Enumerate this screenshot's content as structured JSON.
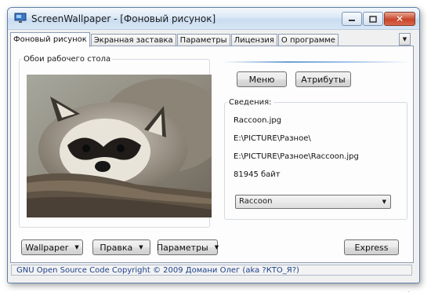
{
  "window": {
    "title": "ScreenWallpaper - [Фоновый рисунок]",
    "icon": "monitor-icon",
    "controls": {
      "minimize": "minimize-icon",
      "maximize": "maximize-icon",
      "close_label": "✕"
    }
  },
  "tabs": [
    {
      "label": "Фоновый рисунок",
      "active": true
    },
    {
      "label": "Экранная заставка"
    },
    {
      "label": "Параметры"
    },
    {
      "label": "Лицензия"
    },
    {
      "label": "О программе"
    }
  ],
  "tab_scroll_icon": "▼",
  "wallpaper_panel": {
    "legend": "Обои рабочего стола",
    "image": "raccoon-photo"
  },
  "top_buttons": {
    "menu": "Меню",
    "attributes": "Атрибуты"
  },
  "info": {
    "legend": "Сведения:",
    "file_name": "Raccoon.jpg",
    "folder": "E:\\PICTURE\\Разное\\",
    "full_path": "E:\\PICTURE\\Разное\\Raccoon.jpg",
    "size": "81945 байт",
    "selected_item": "Raccoon"
  },
  "bottom_buttons": {
    "wallpaper": "Wallpaper",
    "edit": "Правка",
    "params": "Параметры",
    "express": "Express"
  },
  "status": "GNU Open Source Code  Copyright © 2009 Домани Олег (aka ?КТО_Я?)",
  "watermark": "."
}
